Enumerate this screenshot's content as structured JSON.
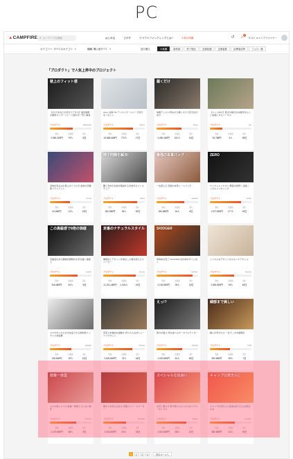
{
  "heading": "PC",
  "header": {
    "logo": "CAMPFIRE",
    "search_placeholder": "キーワードを検索",
    "nav": [
      "はじめる",
      "さがす",
      "クラウドファンディングとは?",
      "人気の特集"
    ],
    "user_name": "ゲスト キャンプファイヤー",
    "notification_count": "3"
  },
  "filters": {
    "category": "カテゴリー: すべてのカテゴリ",
    "type": "種類: 購入型すべて",
    "sort": "並び替え",
    "tabs": [
      "人気順",
      "新着順",
      "終了間近",
      "支援総額",
      "支援者数",
      "目標達成率",
      "フォロー数"
    ],
    "active_tab": 0
  },
  "section_title": "「プロダクト」で人気上昇中のプロジェクト",
  "stat_labels": [
    "現在",
    "支援者",
    "残り"
  ],
  "cards": [
    {
      "caption": "極上のフィット感",
      "title": "【1分であなたの足をケアする】独自開発の脚用マッサージャーで疲れを一気に解消",
      "category": "プロダクト",
      "tag": "Makuake",
      "progress": 0.55,
      "amount": "2,980,280円",
      "backers": "79人",
      "days": "8日",
      "colors": [
        "#1b1b1b",
        "#555555"
      ]
    },
    {
      "caption": "",
      "title": "apure 最新 3D アイマッサージャーで目元をリセット",
      "category": "プロダクト",
      "tag": "apure",
      "progress": 0.72,
      "amount": "15,668,668円",
      "backers": "772人",
      "days": "17日",
      "colors": [
        "#dfe3e6",
        "#b9c1c7"
      ]
    },
    {
      "caption": "履くだけ",
      "title": "快眠アシスト!寝ながら履くだけで足元ぽかぽか",
      "category": "プロダクト",
      "tag": "sleep",
      "progress": 0.6,
      "amount": "4,280,480円",
      "backers": "181人",
      "days": "24日",
      "colors": [
        "#2a2a2a",
        "#8a7a6a"
      ]
    },
    {
      "caption": "",
      "title": "【ペット向け】愛犬の毎日のお散歩をもっと快適にするハーネス",
      "category": "プロダクト",
      "tag": "pet",
      "progress": 0.3,
      "amount": "26,788円",
      "backers": "4人",
      "days": "28日",
      "colors": [
        "#6c7a5a",
        "#b6a48a"
      ]
    },
    {
      "caption": "",
      "title": "身体を包み込む極上のくつろぎ 最新の高機能ブランケット",
      "category": "プロダクト",
      "tag": "home",
      "progress": 0.48,
      "amount": "62,880円",
      "backers": "13人",
      "days": "19日",
      "colors": [
        "#3a4a7a",
        "#c4516a"
      ]
    },
    {
      "caption": "椅子問題を解決!",
      "title": "腰と背中の負担を軽減する次世代オフィスチェア",
      "category": "プロダクト",
      "tag": "office",
      "progress": 0.82,
      "amount": "282,580円",
      "backers": "28人",
      "days": "30日",
      "colors": [
        "#d9d9d9",
        "#4a4a4a"
      ]
    },
    {
      "caption": "最強の本革バッグ",
      "title": "一生使える 究極の本革トートバッグ",
      "category": "プロダクト",
      "tag": "leather",
      "progress": 0.67,
      "amount": "280,880円",
      "backers": "16人",
      "days": "8日",
      "colors": [
        "#e7c7c0",
        "#8b5a3c"
      ]
    },
    {
      "caption": "ZERO",
      "title": "ワイヤレスイヤホン 無音の世界へ 最新ノイズキャンセリング",
      "category": "プロダクト",
      "tag": "audio",
      "progress": 0.75,
      "amount": "1,577,880円",
      "backers": "177人",
      "days": "20日",
      "colors": [
        "#111111",
        "#333333"
      ]
    },
    {
      "caption": "この高級感で8倍の価値",
      "title": "高級感のある機械式腕時計を手の届く価格で",
      "category": "プロダクト",
      "tag": "watch",
      "progress": 0.66,
      "amount": "516,880円",
      "backers": "81人",
      "days": "5日",
      "colors": [
        "#101010",
        "#6b6b6b"
      ]
    },
    {
      "caption": "定番のナチュラルスタイル",
      "title": "機能性とデザインを両立した毎日使えるスニーカー",
      "category": "プロダクト",
      "tag": "shoes",
      "progress": 0.78,
      "amount": "11,151,480円",
      "backers": "1,024人",
      "days": "10日",
      "colors": [
        "#2c1a1a",
        "#c0392b"
      ]
    },
    {
      "caption": "SKIDGER",
      "title": "革命的な包丁 SKIDGER 切れ味がずっと続く",
      "category": "プロダクト",
      "tag": "kitchen",
      "progress": 0.86,
      "amount": "2,130,880円",
      "backers": "39人",
      "days": "13日",
      "colors": [
        "#b34a1d",
        "#2b2b2b"
      ]
    },
    {
      "caption": "",
      "title": "ミニマルなデザインのスキンケアボトル",
      "category": "プロダクト",
      "tag": "beauty",
      "progress": 0.58,
      "amount": "2,890,880円",
      "backers": "93人",
      "days": "45日",
      "colors": [
        "#efe4d6",
        "#c7b39a"
      ]
    },
    {
      "caption": "",
      "title": "スマホを入れたまま充電できる財布型ワイヤレス充電器",
      "category": "プロダクト",
      "tag": "gadget",
      "progress": 0.52,
      "amount": "128,650円",
      "backers": "29人",
      "days": "10日",
      "colors": [
        "#ededed",
        "#6a6a6a"
      ]
    },
    {
      "caption": "",
      "title": "自宅で本格的な運動を 折りたたみ式トレーニングマシン",
      "category": "プロダクト",
      "tag": "fitness",
      "progress": 0.7,
      "amount": "2,520,880円",
      "backers": "73人",
      "days": "18日",
      "colors": [
        "#3a3a3a",
        "#9a7a5a"
      ]
    },
    {
      "caption": "えっ!?",
      "title": "驚きの軽さ 持ち運べるポータブルモニター",
      "category": "プロダクト",
      "tag": "display",
      "progress": 0.62,
      "amount": "1,020,880円",
      "backers": "61人",
      "days": "26日",
      "colors": [
        "#1d1d1d",
        "#7b7b7b"
      ]
    },
    {
      "caption": "細部まで美しい",
      "title": "職人が手がける 一生モノの木製時計",
      "category": "プロダクト",
      "tag": "craft",
      "progress": 0.49,
      "amount": "500,880円",
      "backers": "29人",
      "days": "7日",
      "colors": [
        "#4a2a1a",
        "#c89a5a"
      ]
    },
    {
      "caption": "前後一体型",
      "title": "スマホ用ジンバル 前後一体型でブレない撮影",
      "category": "プロダクト",
      "tag": "camera",
      "progress": 0.64,
      "amount": "2,197,880円",
      "backers": "56人",
      "days": "5日",
      "colors": [
        "#a93a2a",
        "#d8c8b0"
      ]
    },
    {
      "caption": "",
      "title": "暖かさを閉じ込める 究極のフリースパーカー",
      "category": "プロダクト",
      "tag": "apparel",
      "progress": 0.55,
      "amount": "1,024,880円",
      "backers": "44人",
      "days": "15日",
      "colors": [
        "#7a2a1a",
        "#c86a3a"
      ]
    },
    {
      "caption": "スペシャルな出会い",
      "title": "お花と暮らす 贈り物にもぴったりのフラワーボックス",
      "category": "プロダクト",
      "tag": "flower",
      "progress": 0.71,
      "amount": "1,510,880円",
      "backers": "88人",
      "days": "12日",
      "colors": [
        "#c0392b",
        "#f0c27a"
      ]
    },
    {
      "caption": "キャンプの焚き火に",
      "title": "キャンプの焚き火に最適な折りたたみ焚き火台",
      "category": "プロダクト",
      "tag": "outdoor",
      "progress": 0.6,
      "amount": "880,880円",
      "backers": "31人",
      "days": "20日",
      "colors": [
        "#e8542a",
        "#f3b05a"
      ]
    }
  ],
  "pagination": {
    "pages": [
      "1",
      "2",
      "3",
      "4"
    ],
    "current": 0,
    "next": "次のページへ"
  }
}
